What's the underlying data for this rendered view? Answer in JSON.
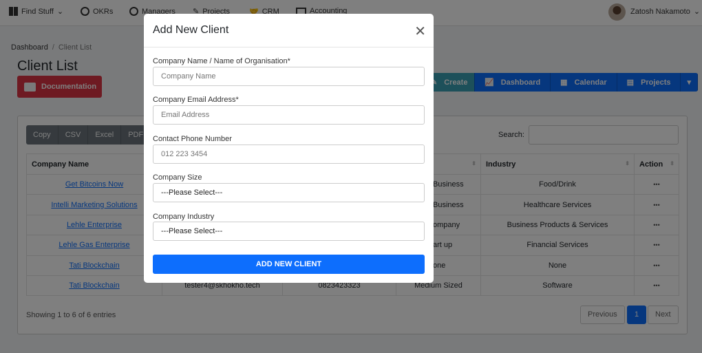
{
  "nav": {
    "items": [
      {
        "label": "Find Stuff",
        "icon": "grid-icon"
      },
      {
        "label": "OKRs",
        "icon": "target-icon"
      },
      {
        "label": "Managers",
        "icon": "user-circle-icon"
      },
      {
        "label": "Projects",
        "icon": "edit-icon"
      },
      {
        "label": "CRM",
        "icon": "handshake-icon"
      },
      {
        "label": "Accounting",
        "icon": "money-icon"
      }
    ],
    "user": "Zatosh Nakamoto"
  },
  "breadcrumb": {
    "home": "Dashboard",
    "sep": "/",
    "current": "Client List"
  },
  "page": {
    "title": "Client List",
    "documentation": "Documentation"
  },
  "toolbar": {
    "create": "Create",
    "dashboard": "Dashboard",
    "calendar": "Calendar",
    "projects": "Projects"
  },
  "colors": {
    "primary": "#0d6efd",
    "danger": "#dc3545",
    "info": "#3aa0b4"
  },
  "table": {
    "export": [
      "Copy",
      "CSV",
      "Excel",
      "PDF"
    ],
    "search_label": "Search:",
    "headers": [
      "Company Name",
      "",
      "",
      "",
      "Industry",
      "Action"
    ],
    "rows": [
      {
        "name": "Get Bitcoins Now",
        "email": "",
        "phone": "",
        "size": "Business",
        "industry": "Food/Drink",
        "action": "•••"
      },
      {
        "name": "Intelli Marketing Solutions",
        "email": "",
        "phone": "",
        "size": "Business",
        "industry": "Healthcare Services",
        "action": "•••"
      },
      {
        "name": "Lehle Enterprise",
        "email": "",
        "phone": "",
        "size": "ompany",
        "industry": "Business Products & Services",
        "action": "•••"
      },
      {
        "name": "Lehle Gas Enterprise",
        "email": "",
        "phone": "",
        "size": "art up",
        "industry": "Financial Services",
        "action": "•••"
      },
      {
        "name": "Tati Blockchain",
        "email": "",
        "phone": "",
        "size": "one",
        "industry": "None",
        "action": "•••"
      },
      {
        "name": "Tati Blockchain",
        "email": "tester4@skhokho.tech",
        "phone": "0823423323",
        "size": "Medium Sized",
        "industry": "Software",
        "action": "•••"
      }
    ],
    "info": "Showing 1 to 6 of 6 entries",
    "pagination": {
      "previous": "Previous",
      "page": "1",
      "next": "Next"
    }
  },
  "modal": {
    "title": "Add New Client",
    "fields": [
      {
        "label": "Company Name / Name of Organisation*",
        "placeholder": "Company Name",
        "value": ""
      },
      {
        "label": "Company Email Address*",
        "placeholder": "Email Address",
        "value": ""
      },
      {
        "label": "Contact Phone Number",
        "placeholder": "012 223 3454",
        "value": ""
      },
      {
        "label": "Company Size",
        "value": "---Please Select---"
      },
      {
        "label": "Company Industry",
        "value": "---Please Select---"
      }
    ],
    "submit": "ADD NEW CLIENT"
  }
}
